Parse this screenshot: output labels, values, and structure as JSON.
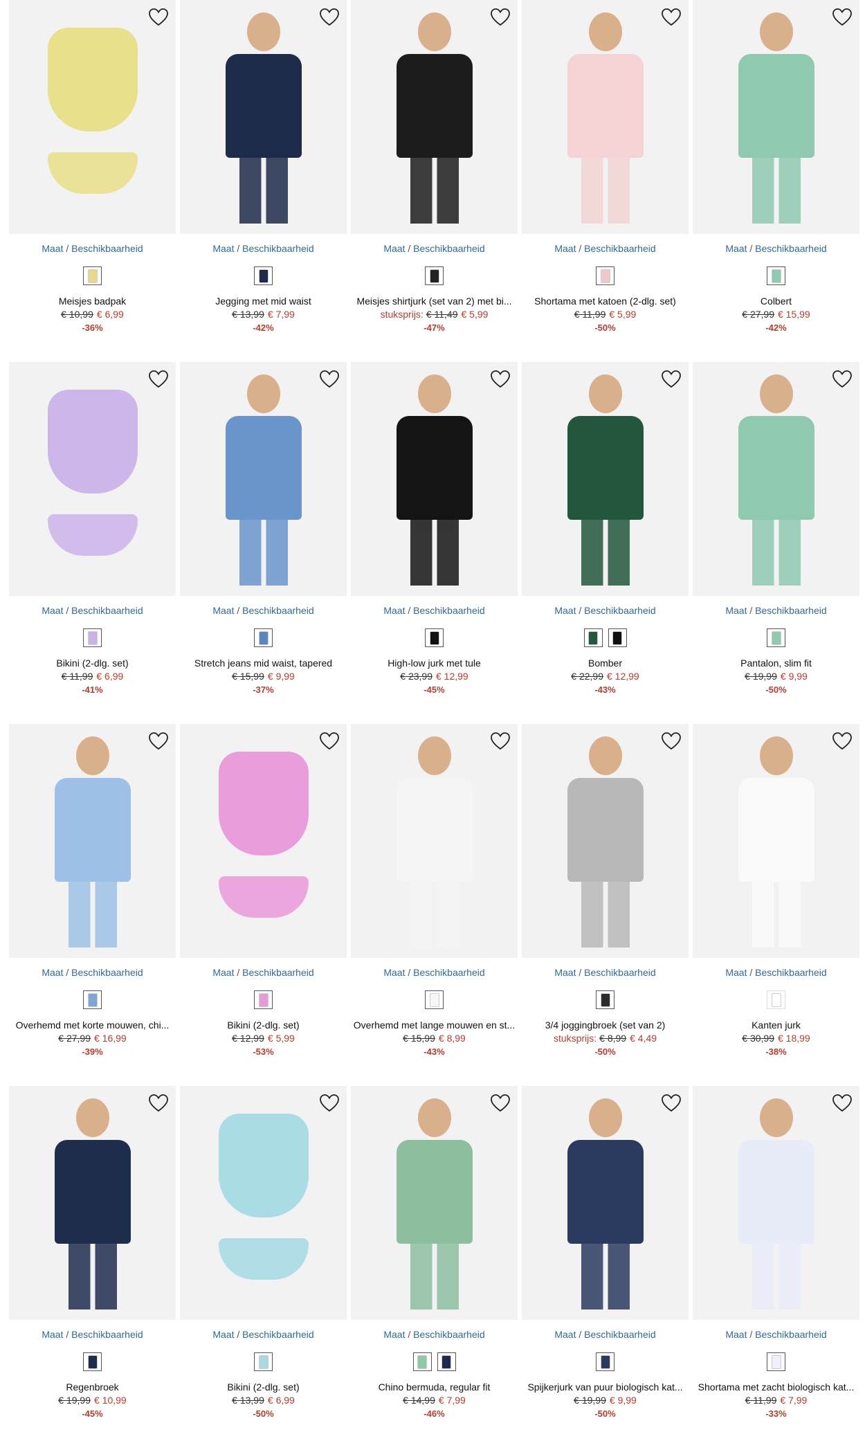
{
  "size_link": {
    "maat": "Maat",
    "sep": "/",
    "availability": "Beschikbaarheid"
  },
  "unit_label": "stuksprijs:",
  "colors": {
    "accent_link": "#2d6aa3",
    "sale_red": "#c0392b",
    "image_bg": "#f2f2f2"
  },
  "products": [
    {
      "title": "Meisjes badpak",
      "old_price": "€ 10,99",
      "new_price": "€ 6,99",
      "discount": "-36%",
      "swatches": [
        "#e8d98a"
      ],
      "garment": "#e9e08c",
      "kind": "flat"
    },
    {
      "title": "Jegging met mid waist",
      "old_price": "€ 13,99",
      "new_price": "€ 7,99",
      "discount": "-42%",
      "swatches": [
        "#1d2a4a"
      ],
      "garment": "#1d2a4a",
      "kind": "person"
    },
    {
      "title": "Meisjes shirtjurk (set van 2) met bi...",
      "unit": true,
      "old_price": "€ 11,49",
      "new_price": "€ 5,99",
      "discount": "-47%",
      "swatches": [
        "#222222"
      ],
      "garment": "#1c1c1c",
      "kind": "person"
    },
    {
      "title": "Shortama met katoen (2-dlg. set)",
      "old_price": "€ 11,99",
      "new_price": "€ 5,99",
      "discount": "-50%",
      "swatches": [
        "#f1c8c8"
      ],
      "garment": "#f3d3d3",
      "kind": "person"
    },
    {
      "title": "Colbert",
      "old_price": "€ 27,99",
      "new_price": "€ 15,99",
      "discount": "-42%",
      "swatches": [
        "#8fc9b0"
      ],
      "garment": "#8fc9b0",
      "kind": "person"
    },
    {
      "title": "Bikini (2-dlg. set)",
      "old_price": "€ 11,99",
      "new_price": "€ 6,99",
      "discount": "-41%",
      "swatches": [
        "#c9b3e6"
      ],
      "garment": "#cdb6ea",
      "kind": "flat"
    },
    {
      "title": "Stretch jeans mid waist, tapered",
      "old_price": "€ 15,99",
      "new_price": "€ 9,99",
      "discount": "-37%",
      "swatches": [
        "#5a86c2"
      ],
      "garment": "#6a94cc",
      "kind": "person"
    },
    {
      "title": "High-low jurk met tule",
      "old_price": "€ 23,99",
      "new_price": "€ 12,99",
      "discount": "-45%",
      "swatches": [
        "#111111"
      ],
      "garment": "#141414",
      "kind": "person"
    },
    {
      "title": "Bomber",
      "old_price": "€ 22,99",
      "new_price": "€ 12,99",
      "discount": "-43%",
      "swatches": [
        "#235a3f",
        "#111111"
      ],
      "garment": "#22573d",
      "kind": "person"
    },
    {
      "title": "Pantalon, slim fit",
      "old_price": "€ 19,99",
      "new_price": "€ 9,99",
      "discount": "-50%",
      "swatches": [
        "#8fc9b0"
      ],
      "garment": "#8fc9b0",
      "kind": "person"
    },
    {
      "title": "Overhemd met korte mouwen, chi...",
      "old_price": "€ 27,99",
      "new_price": "€ 16,99",
      "discount": "-39%",
      "swatches": [
        "#7da6d6"
      ],
      "garment": "#9ec0e6",
      "kind": "person"
    },
    {
      "title": "Bikini (2-dlg. set)",
      "old_price": "€ 12,99",
      "new_price": "€ 5,99",
      "discount": "-53%",
      "swatches": [
        "#e79ad8"
      ],
      "garment": "#ea9ddb",
      "kind": "flat"
    },
    {
      "title": "Overhemd met lange mouwen en st...",
      "old_price": "€ 15,99",
      "new_price": "€ 8,99",
      "discount": "-43%",
      "swatches": [
        "#f7f7f7"
      ],
      "garment": "#f5f5f5",
      "kind": "person"
    },
    {
      "title": "3/4 joggingbroek (set van 2)",
      "unit": true,
      "old_price": "€ 8,99",
      "new_price": "€ 4,49",
      "discount": "-50%",
      "swatches": [
        "#2b2b2b"
      ],
      "garment": "#b8b8b8",
      "kind": "person"
    },
    {
      "title": "Kanten jurk",
      "old_price": "€ 30,99",
      "new_price": "€ 18,99",
      "discount": "-38%",
      "swatches": [
        "#ffffff"
      ],
      "garment": "#fafafa",
      "kind": "person"
    },
    {
      "title": "Regenbroek",
      "old_price": "€ 19,99",
      "new_price": "€ 10,99",
      "discount": "-45%",
      "swatches": [
        "#1f2d4d"
      ],
      "garment": "#1f2d4d",
      "kind": "person"
    },
    {
      "title": "Bikini (2-dlg. set)",
      "old_price": "€ 13,99",
      "new_price": "€ 6,99",
      "discount": "-50%",
      "swatches": [
        "#a8d8e0"
      ],
      "garment": "#a9dce4",
      "kind": "flat"
    },
    {
      "title": "Chino bermuda, regular fit",
      "old_price": "€ 14,99",
      "new_price": "€ 7,99",
      "discount": "-46%",
      "swatches": [
        "#8fc9a8",
        "#1d2a4a"
      ],
      "garment": "#8dbf9f",
      "kind": "person"
    },
    {
      "title": "Spijkerjurk van puur biologisch kat...",
      "old_price": "€ 19,99",
      "new_price": "€ 9,99",
      "discount": "-50%",
      "swatches": [
        "#2a3a5e"
      ],
      "garment": "#2b3b60",
      "kind": "person"
    },
    {
      "title": "Shortama met zacht biologisch kat...",
      "old_price": "€ 11,99",
      "new_price": "€ 7,99",
      "discount": "-33%",
      "swatches": [
        "#eef0fa"
      ],
      "garment": "#e8ecf8",
      "kind": "person"
    }
  ]
}
